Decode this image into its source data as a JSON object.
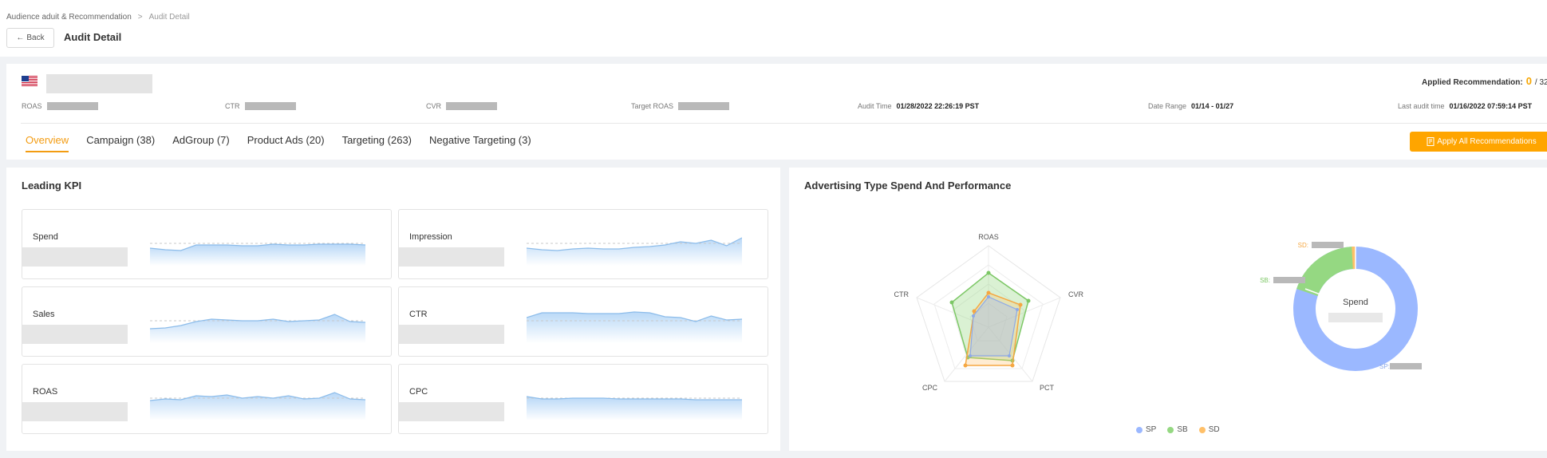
{
  "breadcrumb": {
    "parent": "Audience aduit & Recommendation",
    "separator": ">",
    "current": "Audit Detail"
  },
  "back_button": {
    "icon": "arrow-left-icon",
    "label": "Back"
  },
  "page_title": "Audit Detail",
  "header": {
    "applied_label": "Applied Recommendation:",
    "applied_count": "0",
    "applied_total": "/ 32",
    "metrics": {
      "roas_label": "ROAS",
      "ctr_label": "CTR",
      "cvr_label": "CVR",
      "target_roas_label": "Target ROAS",
      "audit_time_label": "Audit Time",
      "audit_time_value": "01/28/2022 22:26:19 PST",
      "date_range_label": "Date Range",
      "date_range_value": "01/14 - 01/27",
      "last_audit_label": "Last audit time",
      "last_audit_value": "01/16/2022 07:59:14 PST"
    }
  },
  "tabs": [
    {
      "label": "Overview",
      "active": true
    },
    {
      "label": "Campaign (38)",
      "active": false
    },
    {
      "label": "AdGroup (7)",
      "active": false
    },
    {
      "label": "Product Ads (20)",
      "active": false
    },
    {
      "label": "Targeting (263)",
      "active": false
    },
    {
      "label": "Negative Targeting (3)",
      "active": false
    }
  ],
  "apply_button": {
    "icon": "document-check-icon",
    "label": "Apply All Recommendations"
  },
  "leading_kpi": {
    "title": "Leading KPI",
    "cards": [
      {
        "label": "Spend"
      },
      {
        "label": "Impression"
      },
      {
        "label": "Sales"
      },
      {
        "label": "CTR"
      },
      {
        "label": "ROAS"
      },
      {
        "label": "CPC"
      }
    ]
  },
  "ad_type": {
    "title": "Advertising Type Spend And Performance",
    "radar_axes": [
      "ROAS",
      "CVR",
      "PCT",
      "CPC",
      "CTR"
    ],
    "donut_center": "Spend",
    "donut_labels": {
      "sp": "SP:",
      "sb": "SB:",
      "sd": "SD:"
    },
    "legend": [
      {
        "name": "SP",
        "color": "#9bb8ff"
      },
      {
        "name": "SB",
        "color": "#95d882"
      },
      {
        "name": "SD",
        "color": "#ffc069"
      }
    ]
  },
  "colors": {
    "accent": "#ffa500",
    "tab_active": "#f39c12",
    "sp": "#9bb8ff",
    "sb": "#95d882",
    "sd": "#ffc069"
  }
}
